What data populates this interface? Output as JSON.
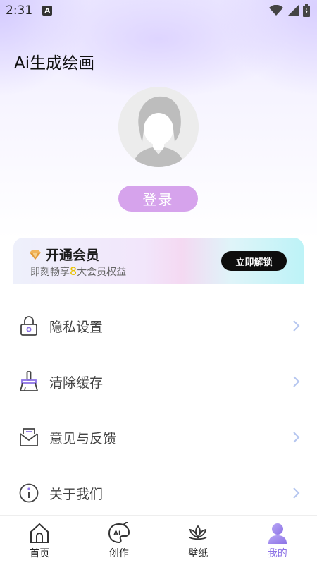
{
  "status_bar": {
    "time": "2:31",
    "badge": "A",
    "icons": [
      "wifi-icon",
      "signal-icon",
      "battery-icon"
    ]
  },
  "header": {
    "title": "Ai生成绘画"
  },
  "profile": {
    "avatar_icon": "default-avatar-icon",
    "login_label": "登录"
  },
  "vip": {
    "title": "开通会员",
    "subtitle_prefix": "即刻畅享",
    "subtitle_number": "8",
    "subtitle_suffix": "大会员权益",
    "button_label": "立即解锁",
    "icon": "diamond-icon"
  },
  "menu": [
    {
      "label": "隐私设置",
      "icon": "lock-icon"
    },
    {
      "label": "清除缓存",
      "icon": "broom-icon"
    },
    {
      "label": "意见与反馈",
      "icon": "mail-icon"
    },
    {
      "label": "关于我们",
      "icon": "info-icon"
    }
  ],
  "tabs": [
    {
      "label": "首页",
      "icon": "home-icon",
      "active": false
    },
    {
      "label": "创作",
      "icon": "palette-icon",
      "active": false
    },
    {
      "label": "壁纸",
      "icon": "lotus-icon",
      "active": false
    },
    {
      "label": "我的",
      "icon": "user-icon",
      "active": true
    }
  ],
  "colors": {
    "accent": "#8d73e6",
    "login_button": "#d6a3ec",
    "vip_button": "#0d0d0d",
    "highlight_number": "#e8c200"
  }
}
